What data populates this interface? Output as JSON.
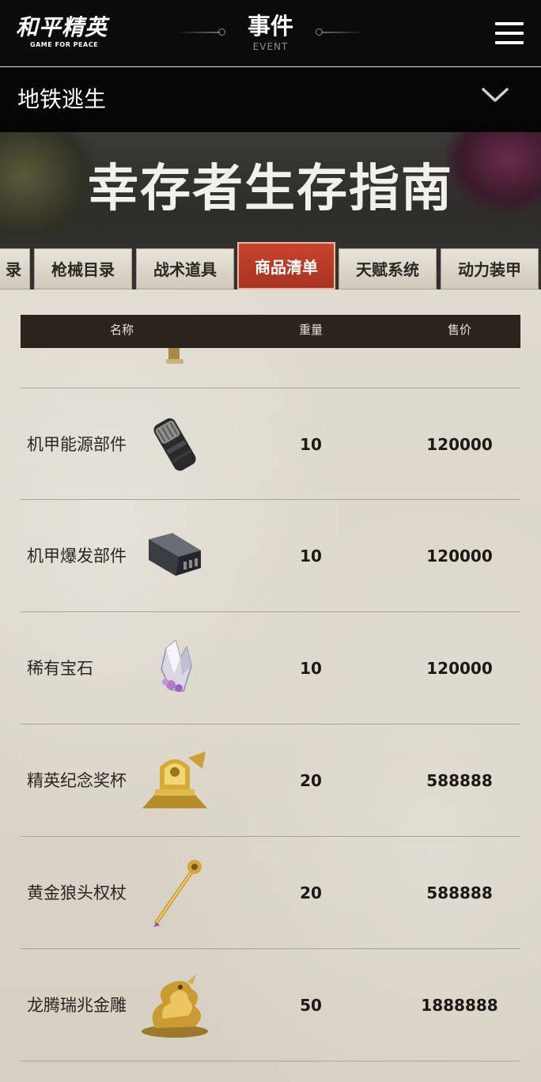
{
  "header": {
    "logo_main": "和平精英",
    "logo_sub": "GAME FOR PEACE",
    "event_title": "事件",
    "event_sub": "EVENT",
    "menu_icon": "hamburger-menu-icon"
  },
  "dropdown": {
    "label": "地铁逃生",
    "icon": "chevron-down-icon"
  },
  "hero": {
    "title": "幸存者生存指南"
  },
  "tabs": [
    {
      "label": "录",
      "active": false
    },
    {
      "label": "枪械目录",
      "active": false
    },
    {
      "label": "战术道具",
      "active": false
    },
    {
      "label": "商品清单",
      "active": true
    },
    {
      "label": "天赋系统",
      "active": false
    },
    {
      "label": "动力装甲",
      "active": false
    }
  ],
  "table": {
    "columns": [
      "名称",
      "重量",
      "售价"
    ],
    "rows": [
      {
        "name": "机甲能源部件",
        "weight": "10",
        "price": "120000",
        "icon": "energy-cylinder-icon"
      },
      {
        "name": "机甲爆发部件",
        "weight": "10",
        "price": "120000",
        "icon": "burst-part-icon"
      },
      {
        "name": "稀有宝石",
        "weight": "10",
        "price": "120000",
        "icon": "gem-crystal-icon"
      },
      {
        "name": "精英纪念奖杯",
        "weight": "20",
        "price": "588888",
        "icon": "trophy-icon"
      },
      {
        "name": "黄金狼头权杖",
        "weight": "20",
        "price": "588888",
        "icon": "scepter-icon"
      },
      {
        "name": "龙腾瑞兆金雕",
        "weight": "50",
        "price": "1888888",
        "icon": "golden-dragon-icon"
      }
    ]
  },
  "colors": {
    "topbar": "#0b0b0b",
    "active_tab": "#c9442f",
    "table_header": "#2a231e",
    "paper": "#d9d3c6"
  }
}
